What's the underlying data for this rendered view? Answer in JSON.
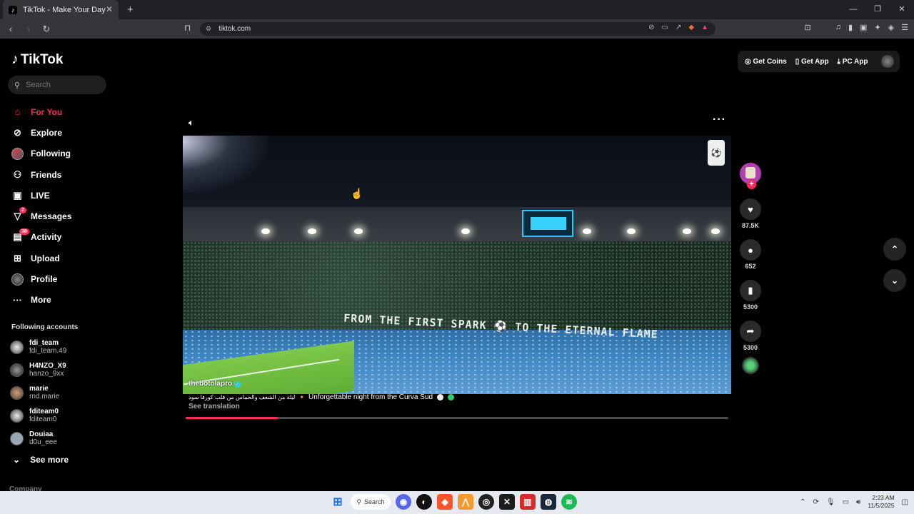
{
  "browser": {
    "tab_title": "TikTok - Make Your Day",
    "url": "tiktok.com"
  },
  "sidebar": {
    "logo": "TikTok",
    "search_placeholder": "Search",
    "nav": [
      {
        "label": "For You",
        "icon": "home-icon",
        "active": true
      },
      {
        "label": "Explore",
        "icon": "compass-icon"
      },
      {
        "label": "Following",
        "icon": "following-avatar-icon"
      },
      {
        "label": "Friends",
        "icon": "friends-icon"
      },
      {
        "label": "LIVE",
        "icon": "live-icon"
      },
      {
        "label": "Messages",
        "icon": "messages-icon",
        "badge": "2"
      },
      {
        "label": "Activity",
        "icon": "activity-icon",
        "badge": "38"
      },
      {
        "label": "Upload",
        "icon": "upload-icon"
      },
      {
        "label": "Profile",
        "icon": "profile-icon"
      },
      {
        "label": "More",
        "icon": "more-icon"
      }
    ],
    "following_title": "Following accounts",
    "accounts": [
      {
        "name": "fdi_team",
        "handle": "fdi_team.49"
      },
      {
        "name": "H4NZO_X9",
        "handle": "hanzo_9xx"
      },
      {
        "name": "marie",
        "handle": "rnd.marie"
      },
      {
        "name": "fditeam0",
        "handle": "fditeam0"
      },
      {
        "name": "Douiaa",
        "handle": "d0u_eee"
      }
    ],
    "see_more": "See more",
    "company": "Company"
  },
  "topbar": {
    "get_coins": "Get Coins",
    "get_app": "Get App",
    "pc_app": "PC App"
  },
  "video": {
    "username": "thebotolapro",
    "banner_text": "FROM THE FIRST SPARK ⚽ TO THE ETERNAL FLAME",
    "caption_arabic": "ليلة من الشغف والحماس من قلب كورفا سود",
    "caption": "Unforgettable night from the Curva Sud",
    "see_translation": "See translation",
    "progress": 0.17
  },
  "actions": {
    "likes": "87.5K",
    "comments": "652",
    "saves": "5300",
    "shares": "5300"
  },
  "taskbar": {
    "search_label": "Search",
    "time": "2:23 AM",
    "date": "11/5/2025"
  },
  "colors": {
    "accent": "#fe2c55",
    "background": "#000000"
  }
}
